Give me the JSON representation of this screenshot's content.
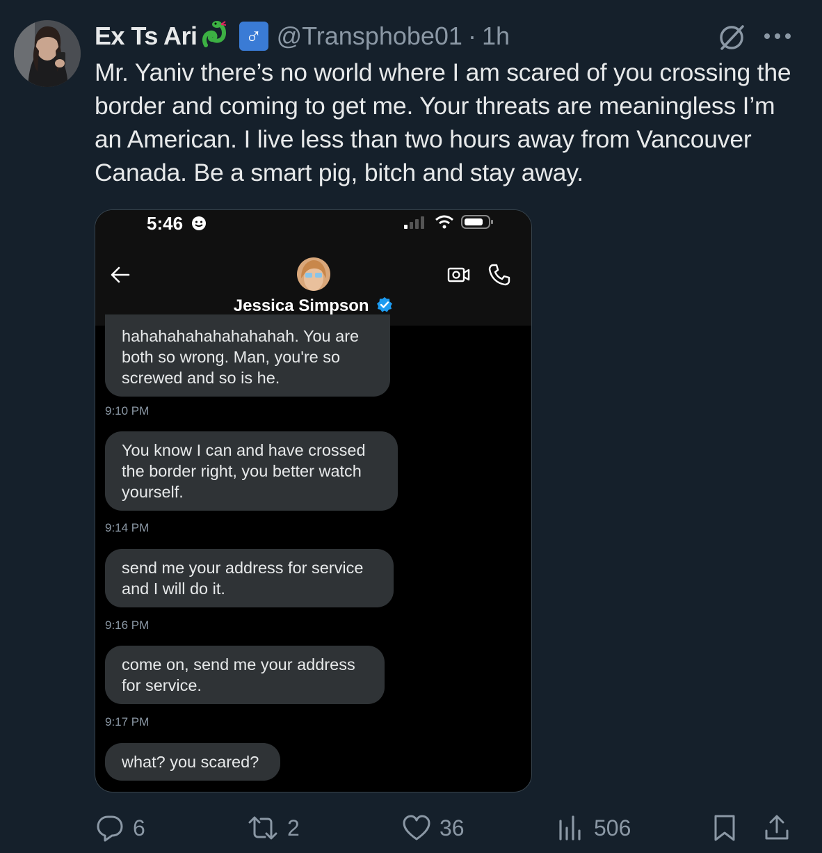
{
  "tweet": {
    "author_name": "Ex Ts Ari",
    "author_emoji": "snake-emoji",
    "author_badge": "♂",
    "handle": "@Transphobe01",
    "separator": "·",
    "time": "1h",
    "text": "Mr. Yaniv there’s no world where I am scared of you crossing the border and coming to get me. Your threats are meaningless I’m an American. I live less than two hours away from Vancouver Canada. Be a smart pig, bitch and stay away."
  },
  "screenshot": {
    "status_time": "5:46",
    "contact_name": "Jessica Simpson",
    "messages": [
      {
        "text": "hahahahahahahahahah. You are both so wrong. Man, you're so screwed and so is he.",
        "time": "9:10 PM"
      },
      {
        "text": "You know I can and have crossed the border right, you better watch yourself.",
        "time": "9:14 PM"
      },
      {
        "text": "send me your address for service and I will do it.",
        "time": "9:16 PM"
      },
      {
        "text": "come on, send me your address for service.",
        "time": "9:17 PM"
      },
      {
        "text": "what? you scared?",
        "time": ""
      }
    ]
  },
  "actions": {
    "replies": "6",
    "reposts": "2",
    "likes": "36",
    "views": "506"
  },
  "colors": {
    "background": "#15202b",
    "text": "#e7e9ea",
    "muted": "#8b98a5",
    "bubble": "#2f3336",
    "verified": "#1d9bf0",
    "gender_badge": "#3a7bd5"
  }
}
